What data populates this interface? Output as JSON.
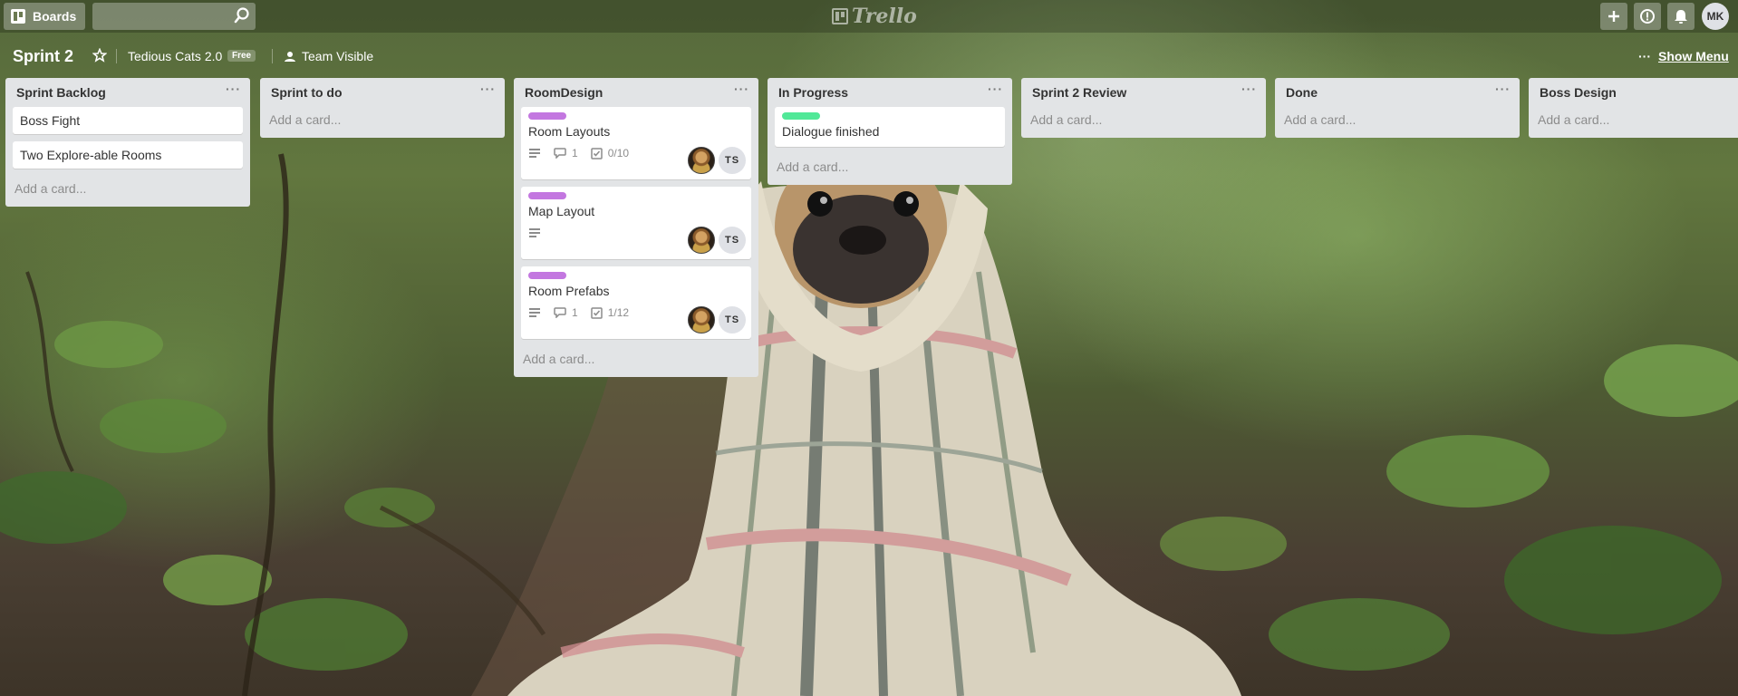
{
  "header": {
    "boards_label": "Boards",
    "search_placeholder": "",
    "logo_text": "Trello",
    "user_initials": "MK"
  },
  "board": {
    "title": "Sprint 2",
    "team_name": "Tedious Cats 2.0",
    "team_plan_badge": "Free",
    "visibility": "Team Visible",
    "show_menu": "Show Menu"
  },
  "lists": [
    {
      "title": "Sprint Backlog",
      "menu": "···",
      "add_card": "Add a card...",
      "cards": [
        {
          "title": "Boss Fight"
        },
        {
          "title": "Two Explore-able Rooms"
        }
      ]
    },
    {
      "title": "Sprint to do",
      "menu": "···",
      "add_card": "Add a card...",
      "cards": []
    },
    {
      "title": "RoomDesign",
      "menu": "···",
      "add_card": "Add a card...",
      "cards": [
        {
          "title": "Room Layouts",
          "label_color": "#c377e0",
          "comments": "1",
          "checklist": "0/10",
          "member_initials": "TS"
        },
        {
          "title": "Map Layout",
          "label_color": "#c377e0",
          "member_initials": "TS"
        },
        {
          "title": "Room Prefabs",
          "label_color": "#c377e0",
          "comments": "1",
          "checklist": "1/12",
          "member_initials": "TS"
        }
      ]
    },
    {
      "title": "In Progress",
      "menu": "···",
      "add_card": "Add a card...",
      "cards": [
        {
          "title": "Dialogue finished",
          "label_color": "#51e898"
        }
      ]
    },
    {
      "title": "Sprint 2 Review",
      "menu": "···",
      "add_card": "Add a card...",
      "cards": []
    },
    {
      "title": "Done",
      "menu": "···",
      "add_card": "Add a card...",
      "cards": []
    },
    {
      "title": "Boss Design",
      "menu": "",
      "add_card": "Add a card...",
      "cards": []
    }
  ],
  "colors": {
    "label_purple": "#c377e0",
    "label_green": "#51e898",
    "list_bg": "#e2e4e6"
  },
  "icons": [
    "boards-icon",
    "search-icon",
    "plus-icon",
    "info-icon",
    "bell-icon",
    "star-icon",
    "team-icon",
    "description-icon",
    "comment-icon",
    "checklist-icon",
    "ellipsis-icon"
  ]
}
